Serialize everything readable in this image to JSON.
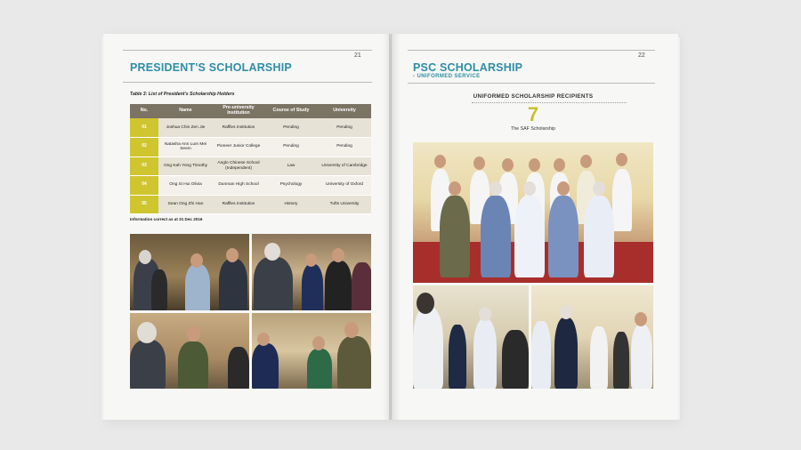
{
  "left_page": {
    "page_number": "21",
    "heading": "PRESIDENT'S SCHOLARSHIP",
    "table_caption": "Table 3: List of President's Scholarship Holders",
    "table_headers": [
      "No.",
      "Name",
      "Pre-university Institution",
      "Course of Study",
      "University"
    ],
    "table_rows": [
      {
        "no": "01",
        "name": "Joshua Chin Zen Jie",
        "institution": "Raffles Institution",
        "course": "Pending",
        "university": "Pending"
      },
      {
        "no": "02",
        "name": "Natasha Ann Lum Mei Seem",
        "institution": "Pioneer Junior College",
        "course": "Pending",
        "university": "Pending"
      },
      {
        "no": "03",
        "name": "Ong Kah Yong Timothy",
        "institution": "Anglo Chinese School (Independent)",
        "course": "Law",
        "university": "University of Cambridge"
      },
      {
        "no": "04",
        "name": "Ong Si Hui Olivia",
        "institution": "Dunman High School",
        "course": "Psychology",
        "university": "University of Oxford"
      },
      {
        "no": "05",
        "name": "Sean Ong Zhi Han",
        "institution": "Raffles Institution",
        "course": "History",
        "university": "Tufts University"
      }
    ],
    "note": "Information correct as at 31 Dec 2016"
  },
  "right_page": {
    "page_number": "22",
    "heading": "PSC SCHOLARSHIP",
    "subheading": "- UNIFORMED SERVICE",
    "section_label": "UNIFORMED SCHOLARSHIP RECIPIENTS",
    "recipient_count": "7",
    "scholarship_name": "The SAF Scholarship"
  },
  "colors": {
    "heading": "#2f8ea4",
    "table_header": "#7b7363",
    "number_cell": "#cfc52f",
    "accent_number": "#c7c02e"
  }
}
